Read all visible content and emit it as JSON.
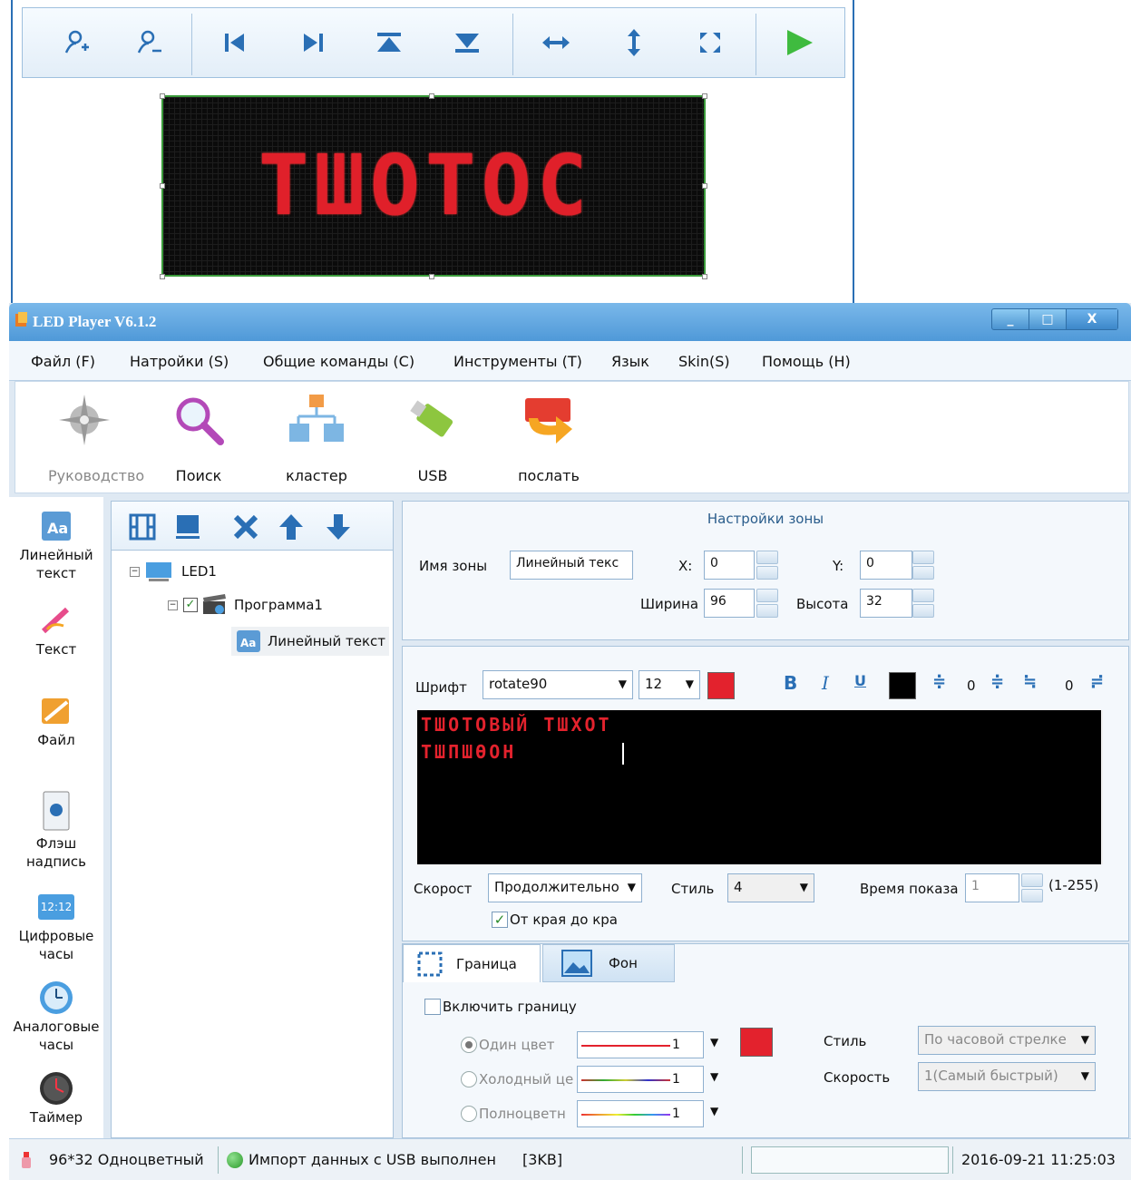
{
  "preview": {
    "led_text": "ТШОТОС"
  },
  "app": {
    "title": "LED Player V6.1.2",
    "window_buttons": [
      "_",
      "□",
      "X"
    ]
  },
  "menu": {
    "items": [
      "Файл (F)",
      "Натройки (S)",
      "Общие команды (C)",
      "Инструменты (T)",
      "Язык",
      "Skin(S)",
      "Помощь (H)"
    ]
  },
  "ribbon": {
    "items": [
      {
        "label": "Руководство",
        "icon": "compass-icon",
        "disabled": true
      },
      {
        "label": "Поиск",
        "icon": "magnifier-icon"
      },
      {
        "label": "кластер",
        "icon": "cluster-icon"
      },
      {
        "label": "USB",
        "icon": "usb-icon"
      },
      {
        "label": "послать",
        "icon": "send-icon"
      }
    ]
  },
  "left_column": {
    "items": [
      {
        "label": "Линейный текст",
        "icon": "line-text-icon"
      },
      {
        "label": "Текст",
        "icon": "text-icon"
      },
      {
        "label": "Файл",
        "icon": "file-icon"
      },
      {
        "label": "Флэш надпись",
        "icon": "flash-icon"
      },
      {
        "label": "Цифровые часы",
        "icon": "digital-clock-icon",
        "display": "12:12"
      },
      {
        "label": "Аналоговые часы",
        "icon": "analog-clock-icon"
      },
      {
        "label": "Таймер",
        "icon": "timer-icon"
      }
    ]
  },
  "tree": {
    "nodes": [
      {
        "label": "LED1"
      },
      {
        "label": "Программа1"
      },
      {
        "label": "Линейный текст"
      }
    ]
  },
  "zone": {
    "title": "Настройки зоны",
    "name_label": "Имя зоны",
    "name_value": "Линейный текс",
    "x_label": "X:",
    "x_value": "0",
    "y_label": "Y:",
    "y_value": "0",
    "width_label": "Ширина",
    "width_value": "96",
    "height_label": "Высота",
    "height_value": "32"
  },
  "editor": {
    "font_label": "Шрифт",
    "font_value": "rotate90",
    "size_value": "12",
    "text_color": "#e3222d",
    "bold": "B",
    "italic": "I",
    "underline": "U",
    "spacing_1": "0",
    "spacing_2": "0",
    "line1": "ТШОТОВЫЙ ТШХОТ",
    "line2": "ТШПШѲОН",
    "speed_label": "Скорост",
    "speed_value": "Продолжительно",
    "style_label": "Стиль",
    "style_value": "4",
    "time_label": "Время показа",
    "time_value": "1",
    "time_range": "(1-255)",
    "edge_label": "От края до кра"
  },
  "border": {
    "tab_border": "Граница",
    "tab_bg": "Фон",
    "enable_label": "Включить границу",
    "one_color": "Один цвет",
    "cold_color": "Холодный це",
    "full_color": "Полноцветн",
    "width_1": "1",
    "width_2": "1",
    "width_3": "1",
    "style_label": "Стиль",
    "style_value": "По часовой стрелке",
    "speed_label": "Скорость",
    "speed_value": "1(Самый быстрый)"
  },
  "status": {
    "mode": "96*32 Одноцветный",
    "message": "Импорт данных с USB выполнен",
    "size": "[3KB]",
    "datetime": "2016-09-21 11:25:03"
  }
}
